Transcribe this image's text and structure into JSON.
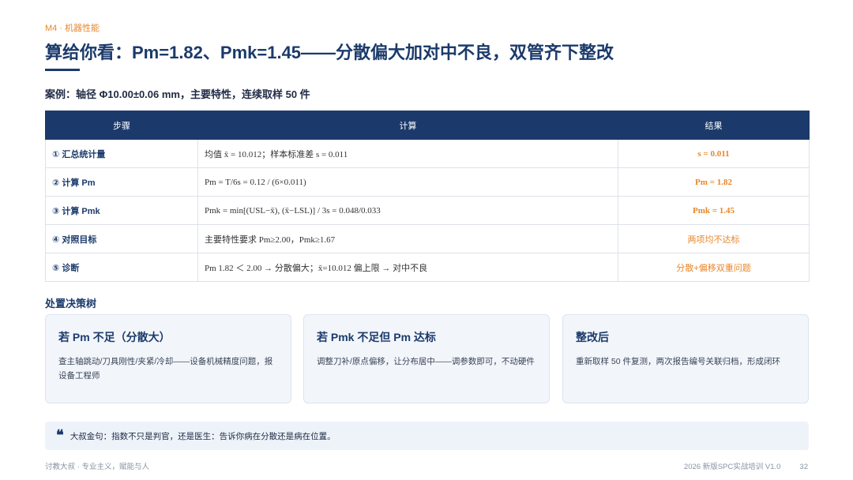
{
  "header": {
    "kicker": "M4 · 机器性能",
    "title": "算给你看：Pm=1.82、Pmk=1.45——分散偏大加对中不良，双管齐下整改",
    "subtitle": "案例：轴径 Φ10.00±0.06 mm，主要特性，连续取样 50 件"
  },
  "table": {
    "headers": [
      "步骤",
      "计算",
      "结果"
    ],
    "rows": [
      {
        "step": "① 汇总统计量",
        "calc": "均值 x̄ = 10.012；样本标准差 s = 0.011",
        "result": "s = 0.011"
      },
      {
        "step": "② 计算 Pm",
        "calc": "Pm = T/6s = 0.12 / (6×0.011)",
        "result": "Pm = 1.82"
      },
      {
        "step": "③ 计算 Pmk",
        "calc": "Pmk = min[(USL−x̄), (x̄−LSL)] / 3s = 0.048/0.033",
        "result": "Pmk = 1.45"
      },
      {
        "step": "④ 对照目标",
        "calc": "主要特性要求 Pm≥2.00，Pmk≥1.67",
        "result": "两项均不达标"
      },
      {
        "step": "⑤ 诊断",
        "calc": "Pm 1.82 ＜ 2.00 → 分散偏大；x̄=10.012 偏上限 → 对中不良",
        "result": "分散+偏移双重问题"
      }
    ]
  },
  "decision_tree": {
    "title": "处置决策树",
    "cards": [
      {
        "heading": "若 Pm 不足（分散大）",
        "body": "查主轴跳动/刀具刚性/夹紧/冷却——设备机械精度问题，报设备工程师"
      },
      {
        "heading": "若 Pmk 不足但 Pm 达标",
        "body": "调整刀补/原点偏移，让分布居中——调参数即可，不动硬件"
      },
      {
        "heading": "整改后",
        "body": "重新取样 50 件复测，两次报告编号关联归档，形成闭环"
      }
    ]
  },
  "quote": {
    "icon": "quote-icon",
    "text": "大叔金句：指数不只是判官，还是医生：告诉你病在分散还是病在位置。"
  },
  "footer": {
    "left": "讨教大叔 · 专业主义，赋能与人",
    "right": "2026 新版SPC实战培训 V1.0",
    "page": "32"
  },
  "colors": {
    "brand": "#1b3a6b",
    "accent": "#e8872b"
  }
}
